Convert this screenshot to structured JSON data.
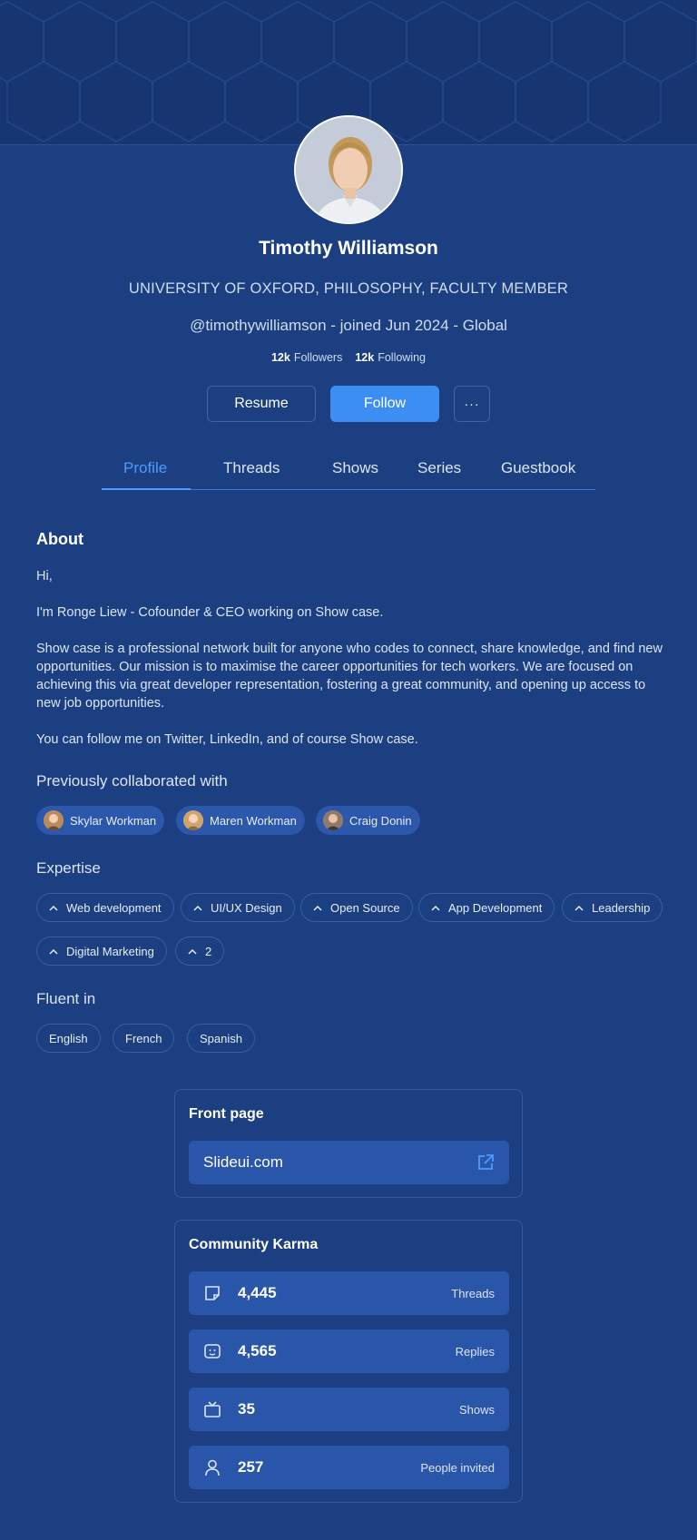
{
  "profile": {
    "name": "Timothy Williamson",
    "affiliation": "UNIVERSITY OF OXFORD, PHILOSOPHY, FACULTY MEMBER",
    "handle_line": "@timothywilliamson - joined Jun 2024 - Global",
    "followers_count": "12k",
    "followers_label": "Followers",
    "following_count": "12k",
    "following_label": "Following"
  },
  "actions": {
    "resume_label": "Resume",
    "follow_label": "Follow",
    "more_label": "···"
  },
  "tabs": [
    {
      "label": "Profile",
      "active": true
    },
    {
      "label": "Threads"
    },
    {
      "label": "Shows"
    },
    {
      "label": "Series"
    },
    {
      "label": "Guestbook"
    }
  ],
  "about": {
    "title": "About",
    "paragraphs": [
      "Hi,",
      "I'm Ronge Liew - Cofounder & CEO working on Show case.",
      "Show case is a professional network built for anyone who codes to connect, share knowledge, and find new opportunities. Our mission is to maximise the career opportunities for tech workers. We are focused on achieving this via great developer representation, fostering a great community, and opening up access to new job opportunities.",
      "You can follow me on Twitter, LinkedIn, and of course Show case."
    ]
  },
  "collaborators": {
    "title": "Previously collaborated with",
    "people": [
      "Skylar Workman",
      "Maren Workman",
      "Craig Donin"
    ]
  },
  "expertise": {
    "title": "Expertise",
    "items": [
      "Web development",
      "UI/UX Design",
      "Open Source",
      "App Development",
      "Leadership",
      "Digital Marketing",
      "2"
    ]
  },
  "languages": {
    "title": "Fluent in",
    "items": [
      "English",
      "French",
      "Spanish"
    ]
  },
  "front_page": {
    "title": "Front page",
    "link": "Slideui.com"
  },
  "karma": {
    "title": "Community Karma",
    "rows": [
      {
        "value": "4,445",
        "label": "Threads",
        "icon": "thread-icon"
      },
      {
        "value": "4,565",
        "label": "Replies",
        "icon": "reply-icon"
      },
      {
        "value": "35",
        "label": "Shows",
        "icon": "tv-icon"
      },
      {
        "value": "257",
        "label": "People invited",
        "icon": "person-icon"
      }
    ]
  },
  "colors": {
    "background": "#1b3f80",
    "accent": "#3d8ef3",
    "active_tab": "#4d9bff",
    "row_fill": "#2a56aa"
  }
}
